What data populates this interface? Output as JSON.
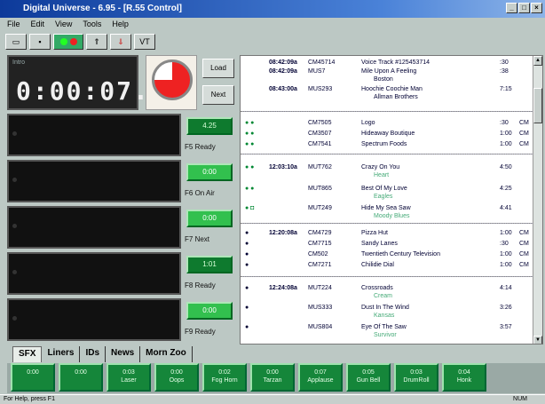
{
  "window": {
    "title": "Digital Universe - 6.95 - [R.55 Control]",
    "buttons": [
      "_",
      "□",
      "×"
    ]
  },
  "menu": [
    "File",
    "Edit",
    "View",
    "Tools",
    "Help"
  ],
  "toolbar": {
    "buttons": [
      "",
      "",
      "",
      "",
      "",
      "VT"
    ]
  },
  "timer": {
    "label": "Intro",
    "value": "0:00:07.8"
  },
  "controls": {
    "load": "Load",
    "next": "Next"
  },
  "carts": [
    {
      "time": "4.25",
      "hotkey": "F5",
      "state": "Ready",
      "lit": false
    },
    {
      "time": "0:00",
      "hotkey": "F6",
      "state": "On Air",
      "lit": true
    },
    {
      "time": "0:00",
      "hotkey": "F7",
      "state": "Next",
      "lit": true
    },
    {
      "time": "1:01",
      "hotkey": "F8",
      "state": "Ready",
      "lit": false
    },
    {
      "time": "0:00",
      "hotkey": "F9",
      "state": "Ready",
      "lit": true
    }
  ],
  "playlist": [
    {
      "time": "08:42:09a",
      "id": "CM45714",
      "title": "Voice Track #125453714",
      "len": ":30",
      "code": "",
      "sub": ""
    },
    {
      "time": "08:42:09a",
      "id": "MUS7",
      "title": "Mile Upon A Feeling",
      "len": ":38",
      "code": "",
      "sub": "Boston"
    },
    {
      "time": "08:43:00a",
      "id": "MUS293",
      "title": "Hoochie Coochie Man",
      "len": "7:15",
      "code": "",
      "sub": "Allman Brothers"
    },
    {
      "time": "",
      "id": "CM7505",
      "title": "Logo",
      "len": ":30",
      "code": "CM",
      "sub": ""
    },
    {
      "time": "",
      "id": "CM3507",
      "title": "Hideaway Boutique",
      "len": "1:00",
      "code": "CM",
      "sub": ""
    },
    {
      "time": "",
      "id": "CM7541",
      "title": "Spectrum Foods",
      "len": "1:00",
      "code": "CM",
      "sub": ""
    },
    {
      "time": "12:03:10a",
      "id": "MUT762",
      "title": "Crazy On You",
      "len": "4:50",
      "code": "",
      "sub": "Heart"
    },
    {
      "time": "",
      "id": "MUT865",
      "title": "Best Of My Love",
      "len": "4:25",
      "code": "",
      "sub": "Eagles"
    },
    {
      "time": "",
      "id": "MUT249",
      "title": "Hide My Sea Saw",
      "len": "4:41",
      "code": "",
      "sub": "Moody Blues"
    },
    {
      "time": "12:20:08a",
      "id": "CM4729",
      "title": "Pizza Hut",
      "len": "1:00",
      "code": "CM",
      "sub": ""
    },
    {
      "time": "",
      "id": "CM7715",
      "title": "Sandy Lanes",
      "len": ":30",
      "code": "CM",
      "sub": ""
    },
    {
      "time": "",
      "id": "CM502",
      "title": "Twentieth Century Television",
      "len": "1:00",
      "code": "CM",
      "sub": ""
    },
    {
      "time": "",
      "id": "CM7271",
      "title": "Chilidie Dial",
      "len": "1:00",
      "code": "CM",
      "sub": ""
    },
    {
      "time": "12:24:08a",
      "id": "MUT224",
      "title": "Crossroads",
      "len": "4:14",
      "code": "",
      "sub": "Cream"
    },
    {
      "time": "",
      "id": "MUS333",
      "title": "Dust In The Wind",
      "len": "3:26",
      "code": "",
      "sub": "Kansas"
    },
    {
      "time": "",
      "id": "MUS804",
      "title": "Eye Of The Saw",
      "len": "3:57",
      "code": "",
      "sub": "Survivor"
    }
  ],
  "tabs": [
    "SFX",
    "Liners",
    "IDs",
    "News",
    "Morn Zoo"
  ],
  "sfx": [
    {
      "time": "0:00",
      "label": ""
    },
    {
      "time": "0:00",
      "label": ""
    },
    {
      "time": "0:03",
      "label": "Laser"
    },
    {
      "time": "0:00",
      "label": "Oops"
    },
    {
      "time": "0:02",
      "label": "Fog Horn"
    },
    {
      "time": "0:00",
      "label": "Tarzan"
    },
    {
      "time": "0:07",
      "label": "Applause"
    },
    {
      "time": "0:05",
      "label": "Gun Bell"
    },
    {
      "time": "0:03",
      "label": "DrumRoll"
    },
    {
      "time": "0:04",
      "label": "Honk"
    }
  ],
  "status": {
    "help": "For Help, press F1",
    "mode": "NUM"
  }
}
